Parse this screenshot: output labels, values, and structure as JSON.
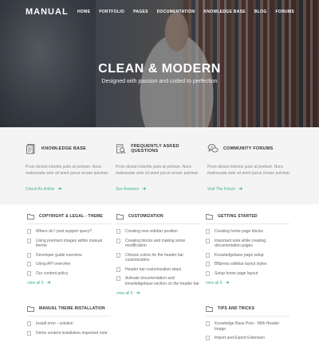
{
  "brand": "MANUAL",
  "nav": [
    "HOME",
    "PORTFOLIO",
    "PAGES",
    "DOCUMENTATION",
    "KNOWLEDGE BASE",
    "BLOG",
    "FORUMS"
  ],
  "hero": {
    "title": "CLEAN & MODERN",
    "subtitle": "Designed with passion and coded to perfection"
  },
  "features": [
    {
      "title": "KNOWLEDGE BASE",
      "desc": "Proin dictum lobortis justo at pretium. Nunc malesuada ante sit amet purus ornare pulvinar.",
      "link": "Check An Article",
      "icon": "document-icon"
    },
    {
      "title": "FREQUENTLY ASKED QUESTIONS",
      "desc": "Proin dictum lobortis justo at pretium. Nunc malesuada ante sit amet purus ornare pulvinar.",
      "link": "See Answers",
      "icon": "search-document-icon"
    },
    {
      "title": "COMMUNITY FORUMS",
      "desc": "Proin dictum lobortis justo at pretium. Nunc malesuada ante sit amet purus ornare pulvinar.",
      "link": "Visit The Forum",
      "icon": "chat-bubbles-icon"
    }
  ],
  "categories": [
    {
      "title": "COPYRIGHT & LEGAL - THEME",
      "items": [
        "Where do I post support query?",
        "Using premium images within manual theme",
        "Developer guide overview",
        "Using API overview",
        "Our content policy"
      ],
      "view_all": "view all 6"
    },
    {
      "title": "CUSTOMIZATION",
      "items": [
        "Creating new sidebar position",
        "Creating blocks and making some modification",
        "Choose colors for the header bar customization",
        "Header bar customization steps",
        "Activate documentation and knowledgebase section on the header bar"
      ],
      "view_all": "view all 6"
    },
    {
      "title": "GETTING STARTED",
      "items": [
        "Creating home page blocks",
        "Important note while creating documentation pages",
        "Knowledgebase page setup",
        "BBpress sidebar layout styles",
        "Setup home page layout"
      ],
      "view_all": "view all 6"
    },
    {
      "title": "MANUAL THEME INSTALLATION",
      "items": [
        "Install error - solution",
        "Demo content installation important note"
      ],
      "view_all": ""
    },
    {
      "title": "TIPS AND TRICKS",
      "items": [
        "Knowledge Base Post - With Header Image",
        "Import and Export Extension"
      ],
      "view_all": ""
    }
  ]
}
